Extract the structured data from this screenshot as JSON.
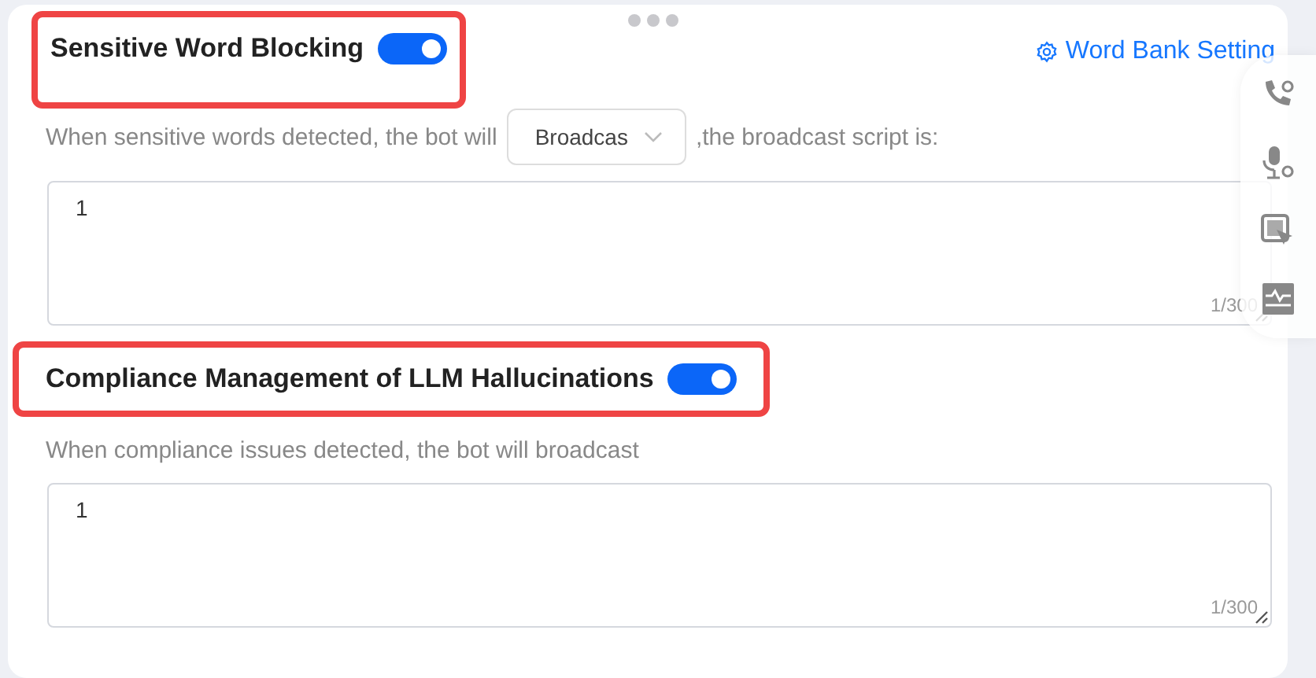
{
  "sections": [
    {
      "title": "Sensitive Word Blocking",
      "enabled": true,
      "highlighted": true,
      "link": "Word Bank Setting",
      "prompt_before": "When sensitive words detected, the bot will",
      "select": "Broadcas",
      "prompt_after": ",the broadcast script is:",
      "script": "1",
      "count": "1/300"
    },
    {
      "title": "Compliance Management of LLM Hallucinations",
      "enabled": true,
      "highlighted": true,
      "prompt_before": "When compliance issues detected, the bot will broadcast",
      "script": "1",
      "count": "1/300"
    }
  ]
}
